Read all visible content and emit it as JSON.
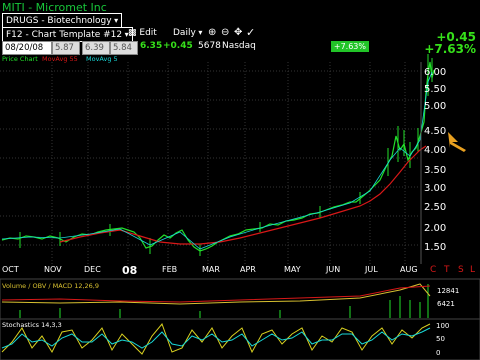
{
  "header": {
    "symbol_title": "MITI - Micromet Inc",
    "industry": "DRUGS - Biotechnology"
  },
  "toolbar": {
    "template": "F12 - Chart Template #12",
    "edit_label": "Edit",
    "period": "Daily"
  },
  "quote": {
    "date": "08/20/08",
    "open": "5.87",
    "high": "6.39",
    "low": "5.84",
    "last": "6.35",
    "change": "+0.45",
    "volume": "5678",
    "exchange": "Nasdaq"
  },
  "header_change": {
    "change": "+0.45",
    "percent": "+7.63%"
  },
  "badge_percent": "+7.63%",
  "legend": {
    "price": "Price Chart",
    "ma1": "MovAvg 55",
    "ma2": "MovAvg 5"
  },
  "price_axis": [
    "6.00",
    "5.50",
    "5.00",
    "4.50",
    "4.00",
    "3.50",
    "3.00",
    "2.50",
    "2.00",
    "1.50"
  ],
  "months": [
    "OCT",
    "NOV",
    "DEC",
    "08",
    "FEB",
    "MAR",
    "APR",
    "MAY",
    "JUN",
    "JUL",
    "AUG"
  ],
  "tf_labels": [
    "C",
    "T",
    "S",
    "L"
  ],
  "volume_panel": {
    "title": "Volume / OBV / MACD 12,26,9",
    "v1": "12841",
    "v2": "6421"
  },
  "stoch_panel": {
    "title": "Stochastics 14,3,3",
    "ticks": [
      "100",
      "50",
      "0"
    ]
  },
  "colors": {
    "price": "#22e02a",
    "ma55": "#d81818",
    "ma5": "#18d8d8",
    "accent": "#22c428"
  }
}
